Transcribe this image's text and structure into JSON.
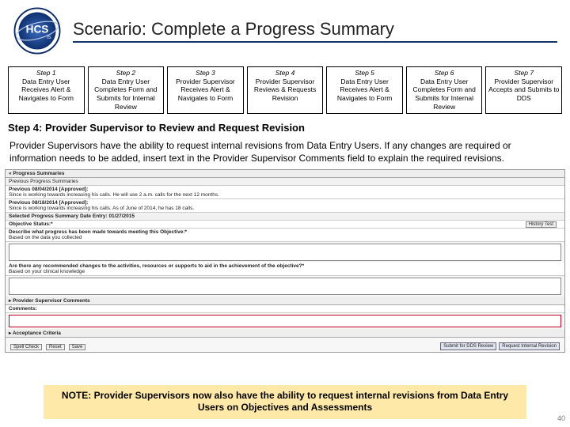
{
  "header": {
    "title": "Scenario: Complete a Progress Summary",
    "logo_text_main": "HCS",
    "logo_text_sub": "is"
  },
  "steps": [
    {
      "label": "Step 1",
      "desc": "Data Entry User Receives Alert & Navigates to Form"
    },
    {
      "label": "Step 2",
      "desc": "Data Entry User Completes Form and Submits for Internal Review"
    },
    {
      "label": "Step 3",
      "desc": "Provider Supervisor Receives Alert & Navigates to Form"
    },
    {
      "label": "Step 4",
      "desc": "Provider Supervisor Reviews & Requests Revision"
    },
    {
      "label": "Step 5",
      "desc": "Data Entry User Receives Alert & Navigates to Form"
    },
    {
      "label": "Step 6",
      "desc": "Data Entry User Completes Form and Submits for Internal Review"
    },
    {
      "label": "Step 7",
      "desc": "Provider Supervisor Accepts and Submits to DDS"
    }
  ],
  "subheading": "Step 4: Provider Supervisor to Review and Request Revision",
  "body": "Provider Supervisors have the ability to request internal revisions from Data Entry Users. If any changes are required or information needs to be added, insert text in the Provider Supervisor Comments field to explain the required revisions.",
  "mock": {
    "section_head": "« Progress Summaries",
    "prev_head": "Previous Progress Summaries",
    "prev1_title": "Previous 08/04/2014 [Approved]:",
    "prev1_body": "Since is working towards increasing his calls. He will use 2 a.m. calls for the next 12 months.",
    "prev2_title": "Previous 08/18/2014 [Approved]:",
    "prev2_body": "Since is working towards increasing his calls. As of June of 2014, he has 18 calls.",
    "selected_head": "Selected Progress Summary Date Entry: 01/27/2015",
    "obj_status": "Objective Status:*",
    "history_btn": "History Test",
    "q1": "Describe what progress has been made towards meeting this Objective:*",
    "q1_sub": "Based on the data you collected",
    "q2": "Are there any recommended changes to the activities, resources or supports to aid in the achievement of the objective?*",
    "q2_sub": "Based on your clinical knowledge",
    "psc_head": "▸ Provider Supervisor Comments",
    "comments_label": "Comments:",
    "acc_head": "▸ Acceptance Criteria",
    "left_btns": [
      "Spell Check",
      "Reset",
      "Save"
    ],
    "right_btns": [
      "Submit for DDS Review",
      "Request Internal Revision"
    ]
  },
  "note": "NOTE: Provider Supervisors now also have the ability to request internal revisions from Data Entry Users on Objectives and Assessments",
  "pagenum": "40"
}
